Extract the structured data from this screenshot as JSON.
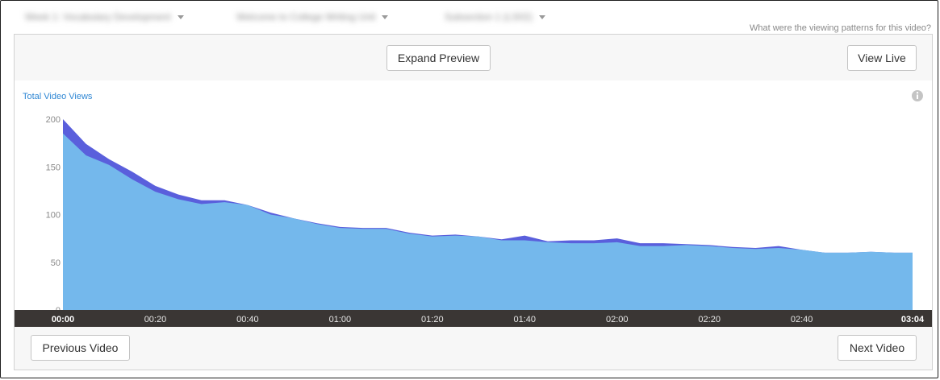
{
  "breadcrumbs": [
    {
      "label": "Week 1: Vocabulary Development"
    },
    {
      "label": "Welcome to College Writing Unit"
    },
    {
      "label": "Subsection 1 (LS02)"
    }
  ],
  "question": "What were the viewing patterns for this video?",
  "buttons": {
    "expand_preview": "Expand Preview",
    "view_live": "View Live",
    "previous_video": "Previous Video",
    "next_video": "Next Video"
  },
  "colors": {
    "series_light": "#74b8ec",
    "series_dark": "#5a5fdc",
    "timeline_bg": "#3a3634",
    "title": "#2f87d4"
  },
  "icons": {
    "info": "info-circle-icon",
    "caret": "caret-down-icon"
  },
  "chart_data": {
    "type": "area",
    "title": "Total Video Views",
    "xlabel": "",
    "ylabel": "",
    "ylim": [
      0,
      200
    ],
    "yticks": [
      0,
      50,
      100,
      150,
      200
    ],
    "xticks": [
      "00:00",
      "00:20",
      "00:40",
      "01:00",
      "01:20",
      "01:40",
      "02:00",
      "02:20",
      "02:40",
      "03:04"
    ],
    "xmax_seconds": 184,
    "x": [
      0,
      5,
      10,
      15,
      20,
      25,
      30,
      35,
      40,
      45,
      50,
      55,
      60,
      65,
      70,
      75,
      80,
      85,
      90,
      95,
      100,
      105,
      110,
      115,
      120,
      125,
      130,
      135,
      140,
      145,
      150,
      155,
      160,
      165,
      170,
      175,
      180,
      184
    ],
    "series": [
      {
        "values": [
          185,
          162,
          152,
          137,
          124,
          116,
          111,
          113,
          110,
          100,
          96,
          90,
          86,
          85,
          85,
          80,
          77,
          78,
          77,
          73,
          73,
          71,
          70,
          70,
          71,
          67,
          67,
          68,
          67,
          65,
          64,
          65,
          63,
          60,
          60,
          61,
          60,
          60
        ]
      },
      {
        "values": [
          200,
          174,
          158,
          145,
          130,
          121,
          115,
          115,
          110,
          102,
          96,
          91,
          87,
          86,
          86,
          81,
          78,
          79,
          77,
          74,
          78,
          72,
          73,
          73,
          75,
          70,
          70,
          69,
          68,
          66,
          65,
          67,
          63,
          60,
          60,
          61,
          60,
          60
        ]
      }
    ]
  }
}
